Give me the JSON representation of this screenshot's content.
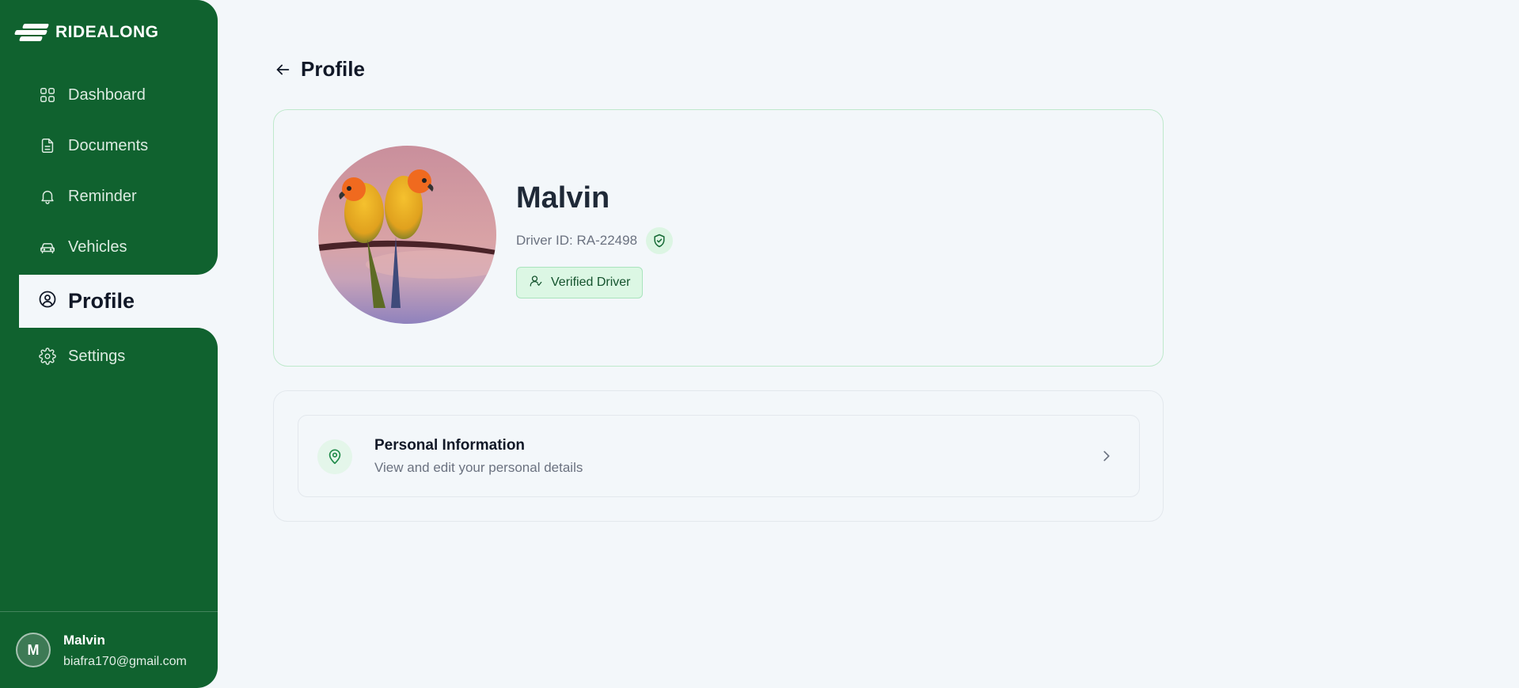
{
  "app": {
    "logo_text": "RIDEALONG"
  },
  "sidebar": {
    "items": [
      {
        "label": "Dashboard",
        "icon": "grid-icon"
      },
      {
        "label": "Documents",
        "icon": "document-icon"
      },
      {
        "label": "Reminder",
        "icon": "bell-icon"
      },
      {
        "label": "Vehicles",
        "icon": "car-icon"
      },
      {
        "label": "Profile",
        "icon": "user-circle-icon",
        "active": true
      },
      {
        "label": "Settings",
        "icon": "gear-icon"
      }
    ],
    "user": {
      "initial": "M",
      "name": "Malvin",
      "email": "biafra170@gmail.com"
    }
  },
  "page": {
    "title": "Profile"
  },
  "profile": {
    "name": "Malvin",
    "driver_id": "Driver ID: RA-22498",
    "badge": "Verified Driver"
  },
  "sections": [
    {
      "title": "Personal Information",
      "subtitle": "View and edit your personal details",
      "icon": "map-pin-icon"
    }
  ],
  "colors": {
    "sidebar": "#10622f",
    "background": "#f3f7fa",
    "accent": "#1f8a49",
    "badge_bg": "#dcf7e4"
  }
}
